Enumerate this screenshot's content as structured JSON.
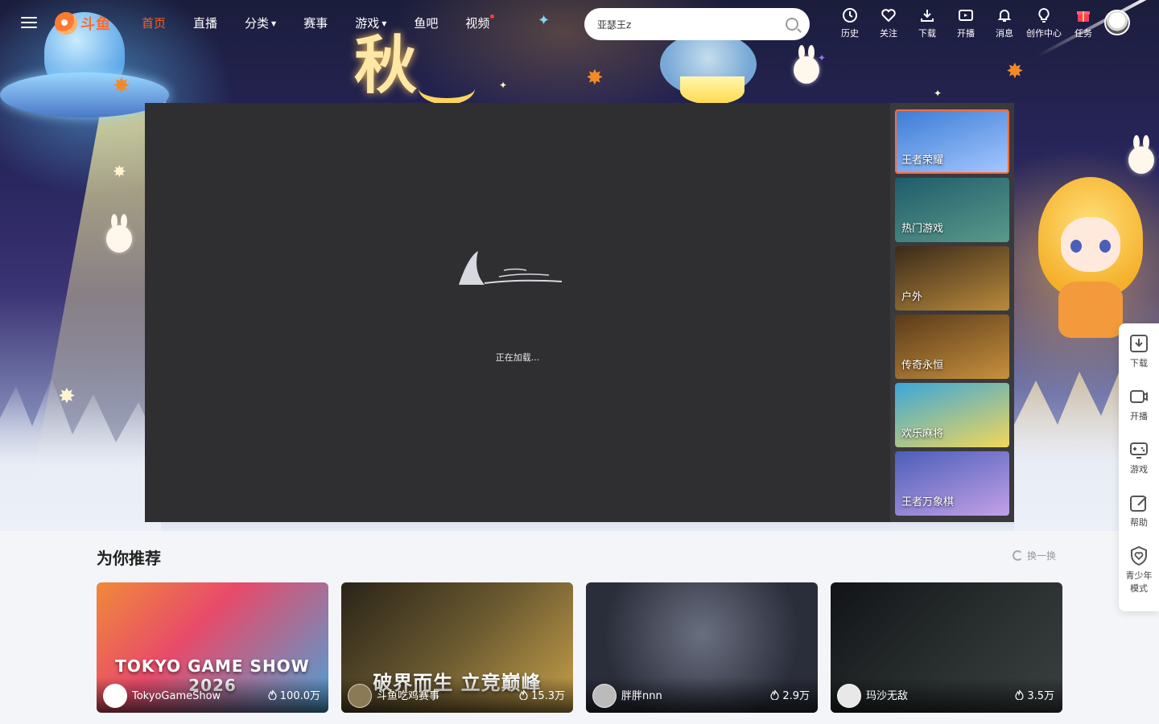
{
  "nav": {
    "logo_text": "斗鱼",
    "links": [
      {
        "label": "首页",
        "active": true
      },
      {
        "label": "直播"
      },
      {
        "label": "分类",
        "caret": "▼"
      },
      {
        "label": "赛事"
      },
      {
        "label": "游戏",
        "caret": "▼"
      },
      {
        "label": "鱼吧"
      },
      {
        "label": "视频",
        "dot": true
      }
    ]
  },
  "search": {
    "value": "亚瑟王z",
    "icon": "search-icon"
  },
  "toolbar": {
    "items": [
      {
        "label": "历史",
        "icon": "clock-icon"
      },
      {
        "label": "关注",
        "icon": "heart-icon"
      },
      {
        "label": "下载",
        "icon": "download-icon"
      },
      {
        "label": "开播",
        "icon": "camera-icon"
      },
      {
        "label": "消息",
        "icon": "bell-icon"
      },
      {
        "label": "创作中心",
        "icon": "lightbulb-icon"
      },
      {
        "label": "任务",
        "icon": "gift-icon"
      }
    ]
  },
  "hero": {
    "title_char": "秋"
  },
  "player": {
    "loading_text": "正在加载..."
  },
  "playlist": [
    {
      "label": "王者荣耀",
      "active": true,
      "colors": [
        "#3a7bd5",
        "#a6c8ff"
      ]
    },
    {
      "label": "热门游戏",
      "colors": [
        "#1f5c6b",
        "#5a9a8a"
      ]
    },
    {
      "label": "户外",
      "colors": [
        "#3a2a1a",
        "#b98a3c"
      ]
    },
    {
      "label": "传奇永恒",
      "colors": [
        "#5a3a1a",
        "#c7913d"
      ]
    },
    {
      "label": "欢乐麻将",
      "colors": [
        "#3aa7d8",
        "#f2d75a"
      ]
    },
    {
      "label": "王者万象棋",
      "colors": [
        "#4a5fb8",
        "#c4a0e8"
      ]
    }
  ],
  "side_dock": [
    {
      "label": "下载",
      "icon": "download-icon"
    },
    {
      "label": "开播",
      "icon": "camera-icon"
    },
    {
      "label": "游戏",
      "icon": "gamepad-icon"
    },
    {
      "label": "帮助",
      "icon": "edit-icon"
    },
    {
      "label": "青少年模式",
      "icon": "shield-heart-icon"
    }
  ],
  "recommend": {
    "title": "为你推荐",
    "refresh_label": "换一换",
    "cards": [
      {
        "streamer": "TokyoGameShow",
        "heat": "100.0万",
        "colors": [
          "#f08a3a",
          "#4aa3d8"
        ],
        "overlay": "TOKYO GAME SHOW 2026"
      },
      {
        "streamer": "斗鱼吃鸡赛事",
        "heat": "15.3万",
        "colors": [
          "#2a2418",
          "#c7a04a"
        ],
        "overlay": "破界而生 立竞巅峰"
      },
      {
        "streamer": "胖胖nnn",
        "heat": "2.9万",
        "colors": [
          "#2a2d3a",
          "#6a6f80"
        ],
        "overlay": ""
      },
      {
        "streamer": "玛沙无敌",
        "heat": "3.5万",
        "colors": [
          "#121417",
          "#3a4040"
        ],
        "overlay": ""
      }
    ]
  },
  "colors": {
    "accent": "#ff5d23",
    "player_bg": "#2f2f31",
    "playlist_bg": "#3a3a3e"
  }
}
